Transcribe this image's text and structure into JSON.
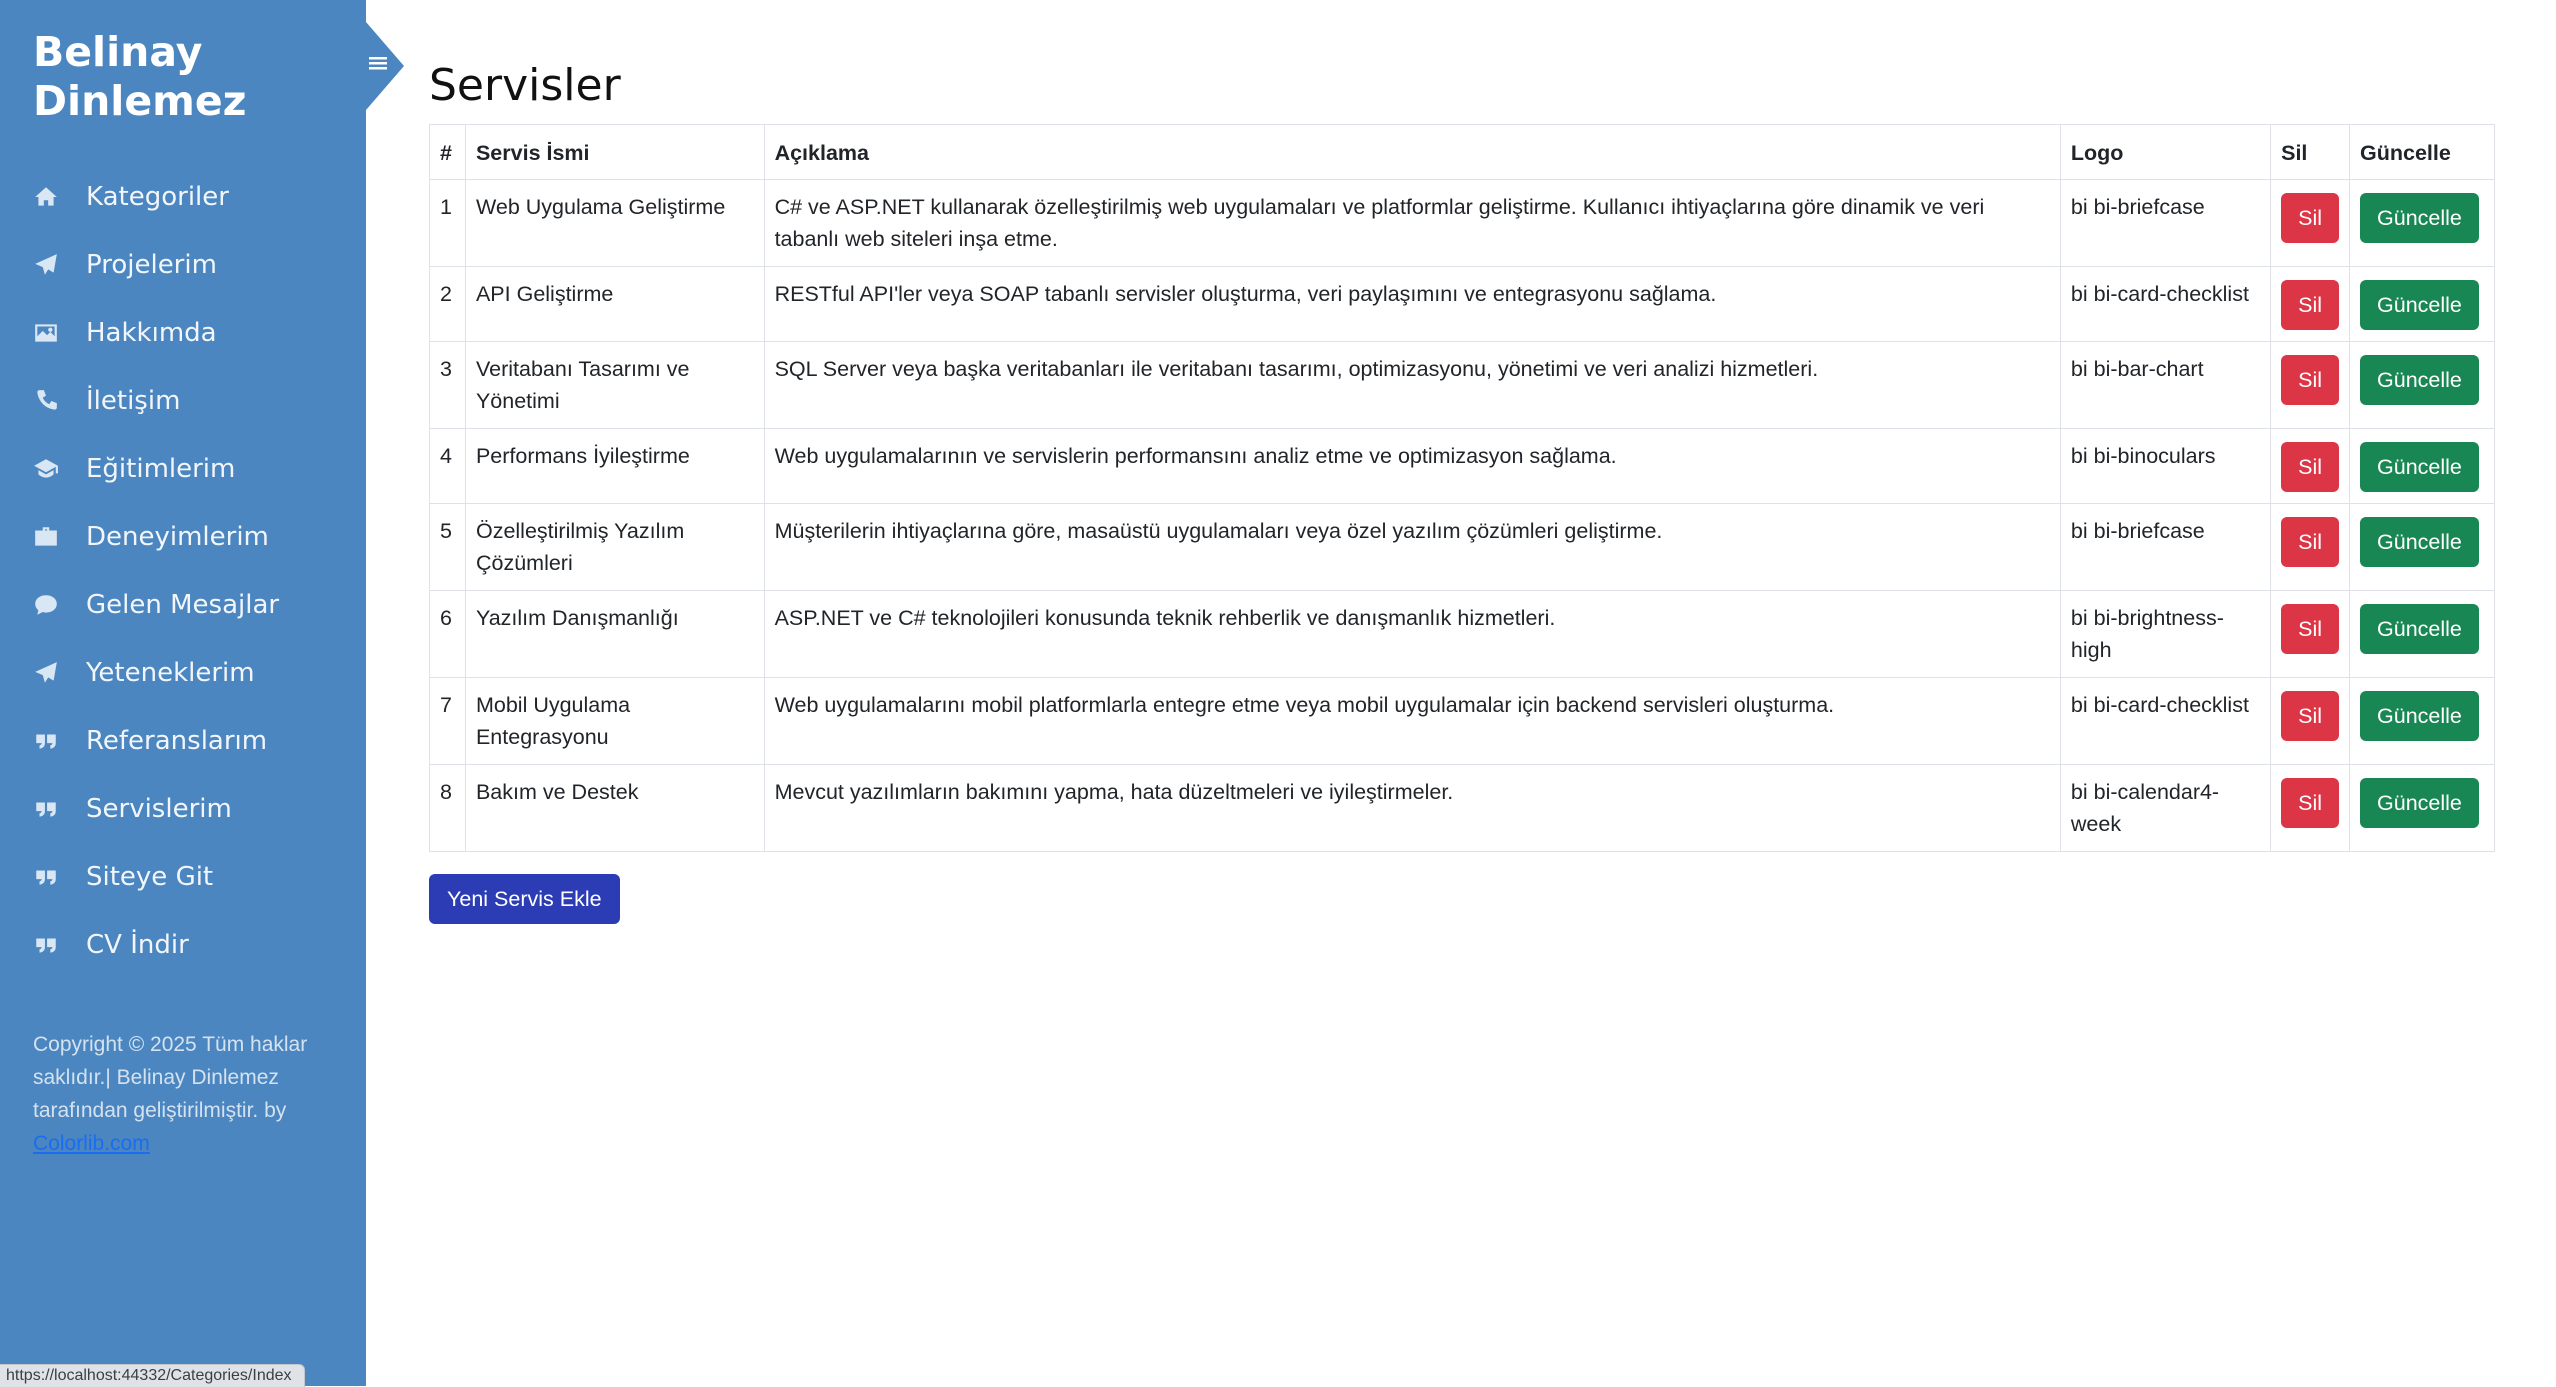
{
  "sidebar": {
    "brand": "Belinay Dinlemez",
    "items": [
      {
        "label": "Kategoriler",
        "icon": "home-icon"
      },
      {
        "label": "Projelerim",
        "icon": "paper-plane-icon"
      },
      {
        "label": "Hakkımda",
        "icon": "image-icon"
      },
      {
        "label": "İletişim",
        "icon": "phone-icon"
      },
      {
        "label": "Eğitimlerim",
        "icon": "graduation-cap-icon"
      },
      {
        "label": "Deneyimlerim",
        "icon": "briefcase-icon"
      },
      {
        "label": "Gelen Mesajlar",
        "icon": "chat-bubble-icon"
      },
      {
        "label": "Yeteneklerim",
        "icon": "paper-plane-icon"
      },
      {
        "label": "Referanslarım",
        "icon": "quote-icon"
      },
      {
        "label": "Servislerim",
        "icon": "quote-icon"
      },
      {
        "label": "Siteye Git",
        "icon": "quote-icon"
      },
      {
        "label": "CV İndir",
        "icon": "quote-icon"
      }
    ],
    "footer_text": "Copyright © 2025 Tüm haklar saklıdır.| Belinay Dinlemez tarafından geliştirilmiştir. by ",
    "footer_link": "Colorlib.com"
  },
  "status_url": "https://localhost:44332/Categories/Index",
  "main": {
    "title": "Servisler",
    "columns": [
      "#",
      "Servis İsmi",
      "Açıklama",
      "Logo",
      "Sil",
      "Güncelle"
    ],
    "rows": [
      {
        "num": "1",
        "name": "Web Uygulama Geliştirme",
        "desc": "C# ve ASP.NET kullanarak özelleştirilmiş web uygulamaları ve platformlar geliştirme. Kullanıcı ihtiyaçlarına göre dinamik ve veri tabanlı web siteleri inşa etme.",
        "logo": "bi bi-briefcase"
      },
      {
        "num": "2",
        "name": "API Geliştirme",
        "desc": "RESTful API'ler veya SOAP tabanlı servisler oluşturma, veri paylaşımını ve entegrasyonu sağlama.",
        "logo": "bi bi-card-checklist"
      },
      {
        "num": "3",
        "name": "Veritabanı Tasarımı ve Yönetimi",
        "desc": "SQL Server veya başka veritabanları ile veritabanı tasarımı, optimizasyonu, yönetimi ve veri analizi hizmetleri.",
        "logo": "bi bi-bar-chart"
      },
      {
        "num": "4",
        "name": "Performans İyileştirme",
        "desc": "Web uygulamalarının ve servislerin performansını analiz etme ve optimizasyon sağlama.",
        "logo": "bi bi-binoculars"
      },
      {
        "num": "5",
        "name": "Özelleştirilmiş Yazılım Çözümleri",
        "desc": "Müşterilerin ihtiyaçlarına göre, masaüstü uygulamaları veya özel yazılım çözümleri geliştirme.",
        "logo": "bi bi-briefcase"
      },
      {
        "num": "6",
        "name": "Yazılım Danışmanlığı",
        "desc": "ASP.NET ve C# teknolojileri konusunda teknik rehberlik ve danışmanlık hizmetleri.",
        "logo": "bi bi-brightness-high"
      },
      {
        "num": "7",
        "name": "Mobil Uygulama Entegrasyonu",
        "desc": "Web uygulamalarını mobil platformlarla entegre etme veya mobil uygulamalar için backend servisleri oluşturma.",
        "logo": "bi bi-card-checklist"
      },
      {
        "num": "8",
        "name": "Bakım ve Destek",
        "desc": "Mevcut yazılımların bakımını yapma, hata düzeltmeleri ve iyileştirmeler.",
        "logo": "bi bi-calendar4-week"
      }
    ],
    "delete_label": "Sil",
    "update_label": "Güncelle",
    "add_button": "Yeni Servis Ekle"
  },
  "colors": {
    "sidebar_bg": "#4b86c0",
    "danger": "#dc3545",
    "success": "#198754",
    "primary": "#2b3cb5"
  }
}
